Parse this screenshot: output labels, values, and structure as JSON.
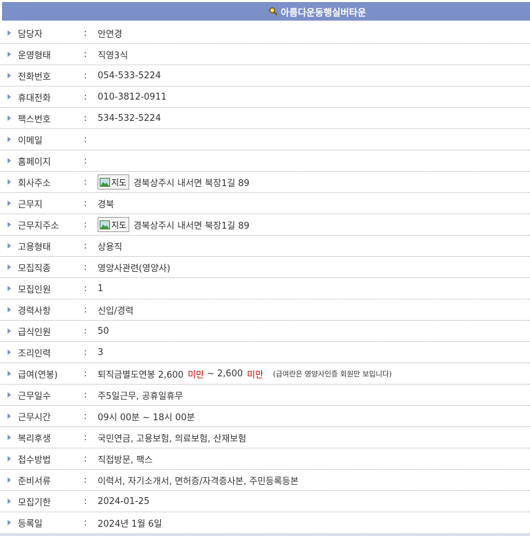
{
  "header": {
    "title": "아름다운동행실버타운",
    "icon": "search-icon"
  },
  "colon": ":",
  "map_label": "지도",
  "rows": [
    {
      "label": "담당자",
      "value": "안연경"
    },
    {
      "label": "운영형태",
      "value": "직영3식"
    },
    {
      "label": "전화번호",
      "value": "054-533-5224"
    },
    {
      "label": "휴대전화",
      "value": "010-3812-0911"
    },
    {
      "label": "팩스번호",
      "value": "534-532-5224"
    },
    {
      "label": "이메일",
      "value": ""
    },
    {
      "label": "홈페이지",
      "value": ""
    },
    {
      "label": "회사주소",
      "value": "경북상주시 내서면 북장1길 89"
    },
    {
      "label": "근무지",
      "value": "경북"
    },
    {
      "label": "근무지주소",
      "value": "경북상주시 내서면 북장1길 89"
    },
    {
      "label": "고용형태",
      "value": "상용직"
    },
    {
      "label": "모집직종",
      "value": "영양사관련(영양사)"
    },
    {
      "label": "모집인원",
      "value": "1"
    },
    {
      "label": "경력사항",
      "value": "신입/경력"
    },
    {
      "label": "급식인원",
      "value": "50"
    },
    {
      "label": "조리인력",
      "value": "3"
    },
    {
      "label": "급여(연봉)",
      "salary_prefix": "퇴직금별도연봉 2,600",
      "salary_min1": "미만",
      "salary_mid": "~ 2,600",
      "salary_min2": "미만",
      "note": "(급여란은 영양사인증 회원만 보입니다)"
    },
    {
      "label": "근무일수",
      "value": "주5일근무, 공휴일휴무"
    },
    {
      "label": "근무시간",
      "value": "09시 00분 ~ 18시 00분"
    },
    {
      "label": "복리후생",
      "value": "국민연금, 고용보험, 의료보험, 산재보험"
    },
    {
      "label": "접수방법",
      "value": "직접방문, 팩스"
    },
    {
      "label": "준비서류",
      "value": "이력서, 자기소개서, 면허증/자격증사본, 주민등록등본"
    },
    {
      "label": "모집기한",
      "value": "2024-01-25"
    },
    {
      "label": "등록일",
      "value": "2024년 1월 6일"
    }
  ]
}
